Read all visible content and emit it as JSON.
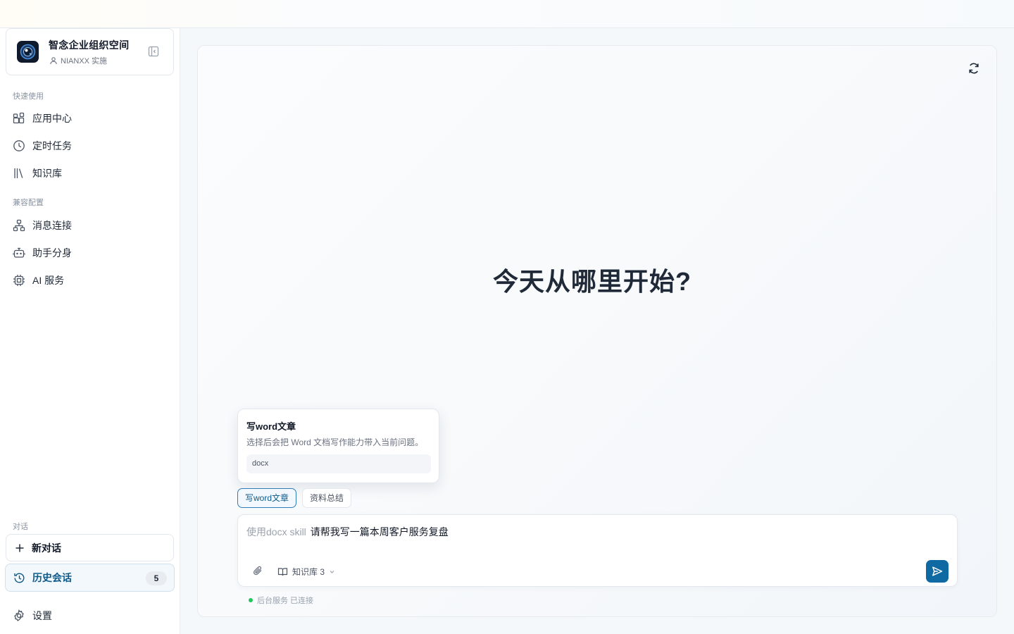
{
  "workspace": {
    "title": "智念企业组织空间",
    "subtitle": "NIANXX 实施"
  },
  "sidebar": {
    "quick_label": "快速使用",
    "quick_items": [
      {
        "label": "应用中心",
        "icon": "apps-icon"
      },
      {
        "label": "定时任务",
        "icon": "clock-icon"
      },
      {
        "label": "知识库",
        "icon": "library-icon"
      }
    ],
    "compat_label": "兼容配置",
    "compat_items": [
      {
        "label": "消息连接",
        "icon": "network-icon"
      },
      {
        "label": "助手分身",
        "icon": "bot-icon"
      },
      {
        "label": "AI 服务",
        "icon": "chip-icon"
      }
    ],
    "chat_label": "对话",
    "new_chat": "新对话",
    "history": "历史会话",
    "history_count": "5",
    "settings": "设置"
  },
  "main": {
    "hero": "今天从哪里开始?",
    "popover": {
      "title": "写word文章",
      "description": "选择后会把 Word 文档写作能力带入当前问题。",
      "tag": "docx"
    },
    "chips": [
      "写word文章",
      "资料总结"
    ],
    "composer": {
      "skill_prefix": "使用docx skill",
      "text": "请帮我写一篇本周客户服务复盘",
      "kb_label": "知识库 3"
    },
    "status": "后台服务 已连接"
  },
  "colors": {
    "accent": "#0f6aa3",
    "status_ok": "#22c55e"
  }
}
